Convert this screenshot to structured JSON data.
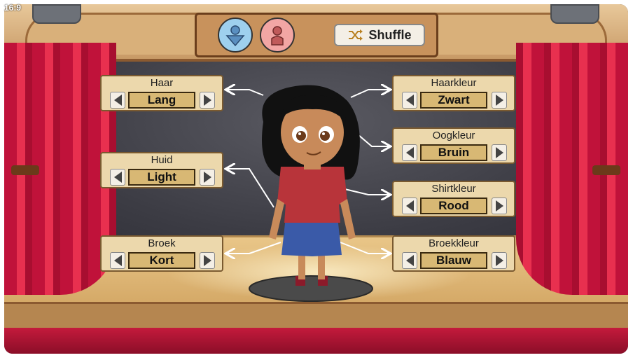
{
  "aspect_label": "16:9",
  "top_panel": {
    "boy_icon": "boy-avatar-icon",
    "girl_icon": "girl-avatar-icon",
    "shuffle_label": "Shuffle",
    "shuffle_icon": "shuffle-icon"
  },
  "options_left": [
    {
      "label": "Haar",
      "value": "Lang"
    },
    {
      "label": "Huid",
      "value": "Light"
    },
    {
      "label": "Broek",
      "value": "Kort"
    }
  ],
  "options_right": [
    {
      "label": "Haarkleur",
      "value": "Zwart"
    },
    {
      "label": "Oogkleur",
      "value": "Bruin"
    },
    {
      "label": "Shirtkleur",
      "value": "Rood"
    },
    {
      "label": "Broekkleur",
      "value": "Blauw"
    }
  ],
  "colors": {
    "shirt": "#b8343a",
    "pants": "#3a5aa8",
    "hair": "#111111",
    "skin": "#c88a5a",
    "eyes": "#6b3a1a"
  }
}
